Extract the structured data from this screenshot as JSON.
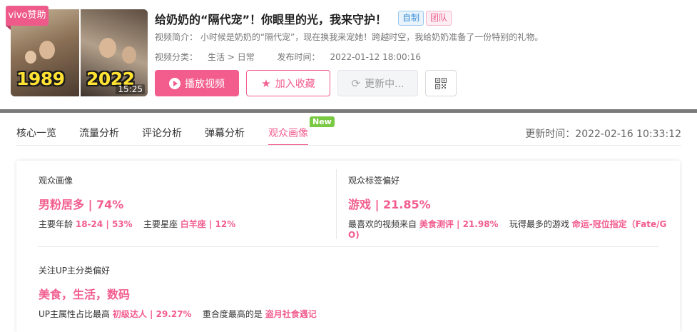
{
  "video": {
    "badge": "vivo赞助",
    "thumb_year_left": "1989",
    "thumb_year_right": "2022",
    "duration": "15:25",
    "title": "给奶奶的“隔代宠”！你眼里的光，我来守护！",
    "tags": [
      "自制",
      "团队"
    ],
    "desc_label": "视频简介：",
    "desc": "小时候是奶奶的“隔代宠”，现在换我来宠她！跨越时空，我给奶奶准备了一份特别的礼物。",
    "category_label": "视频分类：",
    "category": "生活 > 日常",
    "publish_label": "发布时间：",
    "publish_time": "2022-01-12 18:00:16"
  },
  "buttons": {
    "play": "播放视频",
    "favorite": "加入收藏",
    "updating": "更新中..."
  },
  "tabs": {
    "items": [
      "核心一览",
      "流量分析",
      "评论分析",
      "弹幕分析",
      "观众画像"
    ],
    "active_index": 4,
    "new_badge": "New",
    "update_label": "更新时间：",
    "update_time": "2022-02-16 10:33:12"
  },
  "audience": {
    "profile": {
      "label": "观众画像",
      "value": "男粉居多 | 74%",
      "age_label": "主要年龄",
      "age_value": "18-24 | 53%",
      "zodiac_label": "主要星座",
      "zodiac_value": "白羊座 | 12%"
    },
    "tag_pref": {
      "label": "观众标签偏好",
      "value": "游戏 | 21.85%",
      "fav_label": "最喜欢的视频来自",
      "fav_value": "美食测评 | 21.98%",
      "game_label": "玩得最多的游戏",
      "game_value_1": "命运-冠位指定（Fate/G",
      "game_value_2": "O)"
    },
    "up_pref": {
      "label": "关注UP主分类偏好",
      "value": "美食，生活，数码",
      "attr_label": "UP主属性占比最高",
      "attr_value": "初级达人 | 29.27%",
      "overlap_label": "重合度最高的是",
      "overlap_value": "盗月社食遇记"
    }
  },
  "colors": {
    "accent": "#f25d8e",
    "new_badge": "#7ac943",
    "self_tag": "#3a8fd8"
  },
  "icons": {
    "play": "play-circle-icon",
    "favorite": "star-icon",
    "refresh": "refresh-icon",
    "qr": "qr-code-icon"
  }
}
